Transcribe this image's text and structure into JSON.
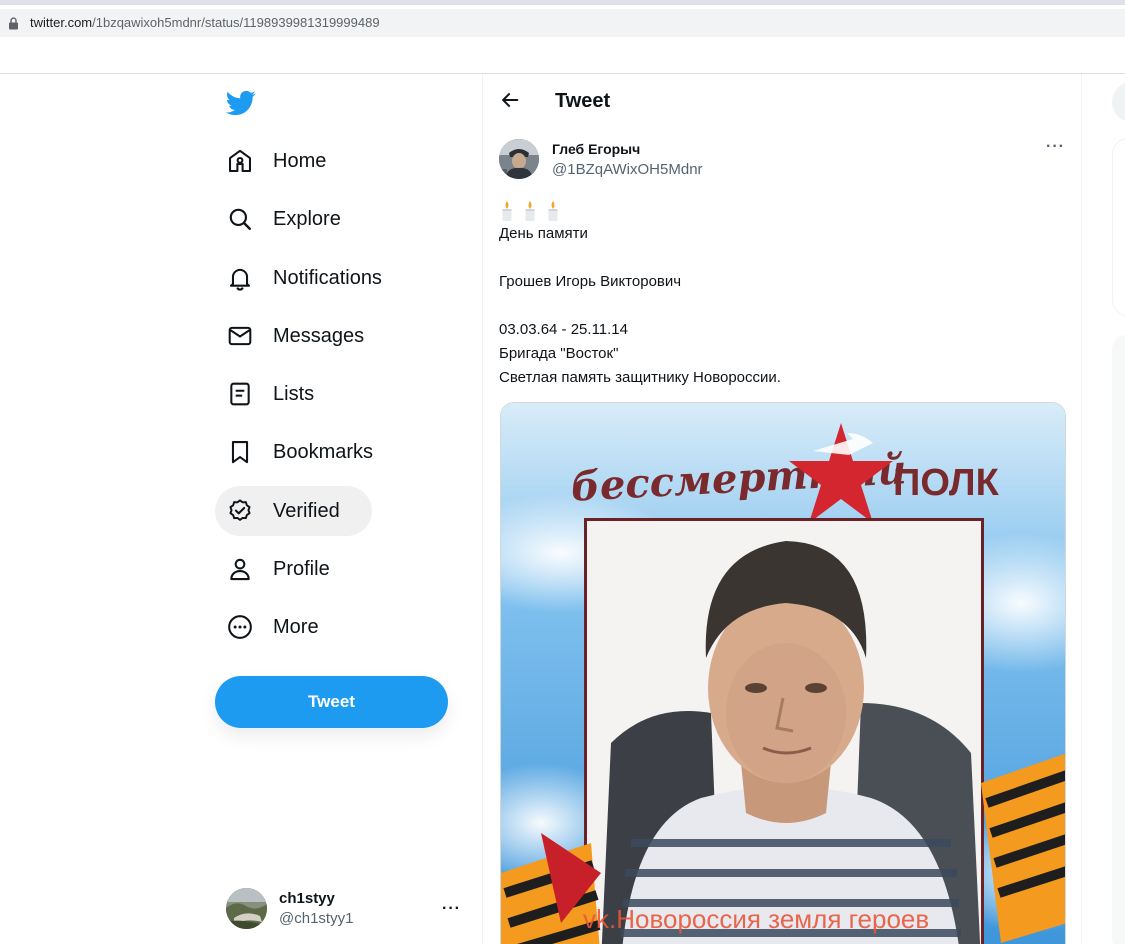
{
  "browser": {
    "url_domain": "twitter.com",
    "url_path": "/1bzqawixoh5mdnr/status/1198939981319999489"
  },
  "sidebar": {
    "logo_icon": "twitter-bird-icon",
    "items": [
      {
        "label": "Home",
        "icon": "home-icon"
      },
      {
        "label": "Explore",
        "icon": "search-icon"
      },
      {
        "label": "Notifications",
        "icon": "bell-icon"
      },
      {
        "label": "Messages",
        "icon": "envelope-icon"
      },
      {
        "label": "Lists",
        "icon": "list-icon"
      },
      {
        "label": "Bookmarks",
        "icon": "bookmark-icon"
      },
      {
        "label": "Verified",
        "icon": "verified-badge-icon",
        "active": true
      },
      {
        "label": "Profile",
        "icon": "person-icon"
      },
      {
        "label": "More",
        "icon": "more-circle-icon"
      }
    ],
    "tweet_button_label": "Tweet",
    "account": {
      "name": "ch1styy",
      "handle": "@ch1styy1",
      "more": "···"
    }
  },
  "main": {
    "header_title": "Tweet",
    "tweet": {
      "author_name": "Глеб Егорыч",
      "author_handle": "@1BZqAWixOH5Mdnr",
      "more": "···",
      "lines": [
        "День памяти",
        "",
        "Грошев Игорь Викторович",
        "",
        "03.03.64 - 25.11.14",
        "Бригада \"Восток\"",
        "Светлая память защитнику Новороссии."
      ],
      "media": {
        "header_script": "бессмертный",
        "header_bold": "ПОЛК",
        "watermark": "vk.Новороссия земля героев"
      }
    }
  },
  "colors": {
    "accent": "#1d9bf0",
    "text": "#0f1419",
    "secondary": "#536471",
    "poster_red": "#c8202a"
  }
}
